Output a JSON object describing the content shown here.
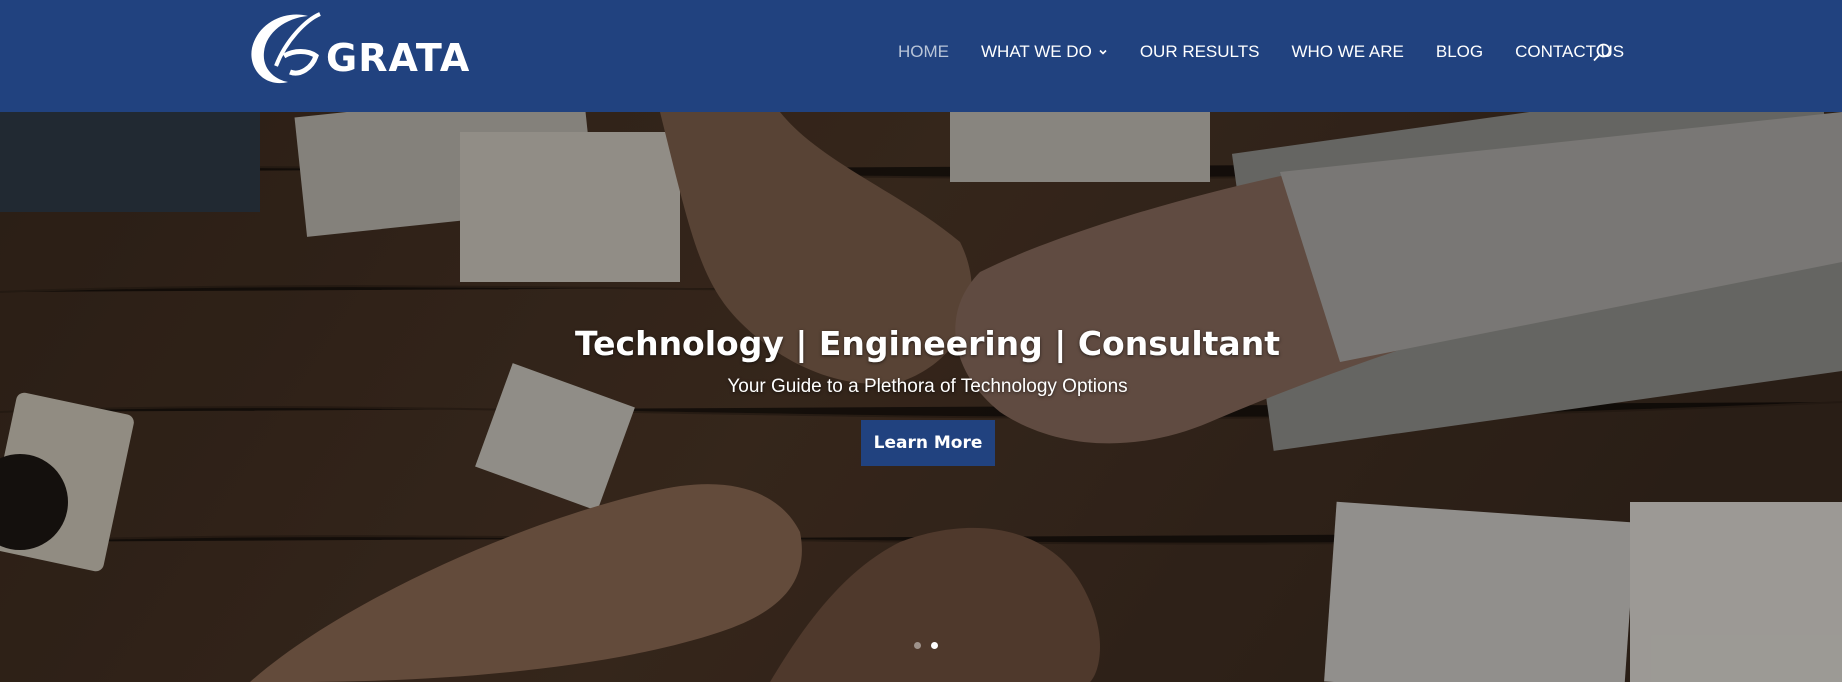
{
  "header": {
    "logo_text": "GRATA",
    "nav": [
      {
        "label": "HOME",
        "active": true
      },
      {
        "label": "WHAT WE DO",
        "has_dropdown": true
      },
      {
        "label": "OUR RESULTS"
      },
      {
        "label": "WHO WE ARE"
      },
      {
        "label": "BLOG"
      },
      {
        "label": "CONTACT US"
      }
    ],
    "search_icon": "search-icon"
  },
  "hero": {
    "title": "Technology | Engineering | Consultant",
    "subtitle": "Your Guide to a Plethora of Technology Options",
    "cta_label": "Learn More",
    "slides": [
      {
        "active": false
      },
      {
        "active": true
      }
    ]
  },
  "colors": {
    "brand": "#21427f",
    "nav_active": "#b9c5d8",
    "text": "#ffffff"
  }
}
